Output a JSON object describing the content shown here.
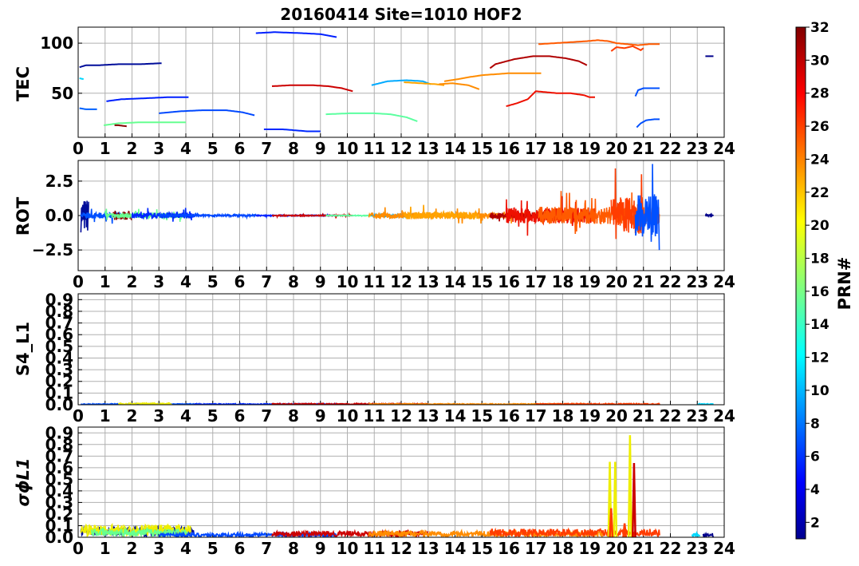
{
  "chart_data": [
    {
      "type": "line",
      "panel": "tec",
      "title": "20160414 Site=1010 HOF2",
      "ylabel": "TEC",
      "xlabel": "",
      "xlim": [
        0,
        24
      ],
      "ylim": [
        6,
        116
      ],
      "xticks": [
        "0",
        "1",
        "2",
        "3",
        "4",
        "5",
        "6",
        "7",
        "8",
        "9",
        "10",
        "11",
        "12",
        "13",
        "14",
        "15",
        "16",
        "17",
        "18",
        "19",
        "20",
        "21",
        "22",
        "23",
        "24"
      ],
      "yticks": [
        "50",
        "100"
      ],
      "grid": true,
      "series": [
        {
          "prn": 3,
          "color": "#000d9a",
          "points": [
            [
              0.05,
              76
            ],
            [
              0.3,
              78
            ],
            [
              0.8,
              78
            ],
            [
              1.5,
              79
            ],
            [
              2.3,
              79
            ],
            [
              3.1,
              80
            ]
          ]
        },
        {
          "prn": 5,
          "color": "#0020ff",
          "points": [
            [
              1.05,
              42
            ],
            [
              1.6,
              44
            ],
            [
              2.5,
              45
            ],
            [
              3.3,
              46
            ],
            [
              4.1,
              46
            ]
          ]
        },
        {
          "prn": 7,
          "color": "#0048ff",
          "points": [
            [
              3.0,
              30
            ],
            [
              3.8,
              32
            ],
            [
              4.6,
              33
            ],
            [
              5.5,
              33
            ],
            [
              6.1,
              31
            ],
            [
              6.55,
              28
            ]
          ]
        },
        {
          "prn": 8,
          "color": "#0060ff",
          "points": [
            [
              0.05,
              35
            ],
            [
              0.3,
              34
            ],
            [
              0.7,
              34
            ]
          ]
        },
        {
          "prn": 5,
          "color": "#0020ff",
          "points": [
            [
              6.6,
              110
            ],
            [
              7.3,
              111
            ],
            [
              8.3,
              110
            ],
            [
              9.0,
              109
            ],
            [
              9.6,
              106
            ]
          ]
        },
        {
          "prn": 6,
          "color": "#0028ff",
          "points": [
            [
              6.9,
              14
            ],
            [
              7.6,
              14
            ],
            [
              8.5,
              12
            ],
            [
              9.0,
              12
            ]
          ]
        },
        {
          "prn": 17,
          "color": "#66ff90",
          "points": [
            [
              0.95,
              18
            ],
            [
              1.5,
              20
            ],
            [
              2.3,
              21
            ],
            [
              3.2,
              21
            ],
            [
              4.0,
              21
            ]
          ]
        },
        {
          "prn": 16,
          "color": "#5cffa0",
          "points": [
            [
              9.2,
              29
            ],
            [
              10.1,
              30
            ],
            [
              11.0,
              30
            ],
            [
              11.6,
              29
            ],
            [
              12.2,
              26
            ],
            [
              12.6,
              22
            ]
          ]
        },
        {
          "prn": 31,
          "color": "#880000",
          "points": [
            [
              1.35,
              18
            ],
            [
              1.5,
              18
            ],
            [
              1.8,
              17
            ]
          ]
        },
        {
          "prn": 29,
          "color": "#cc0000",
          "points": [
            [
              7.2,
              57
            ],
            [
              7.9,
              58
            ],
            [
              8.7,
              58
            ],
            [
              9.3,
              57
            ],
            [
              9.8,
              55
            ],
            [
              10.2,
              52
            ]
          ]
        },
        {
          "prn": 10,
          "color": "#00aaff",
          "points": [
            [
              10.9,
              58
            ],
            [
              11.5,
              62
            ],
            [
              12.2,
              63
            ],
            [
              12.8,
              62
            ],
            [
              13.1,
              59
            ]
          ]
        },
        {
          "prn": 24,
          "color": "#ffa400",
          "points": [
            [
              12.1,
              61
            ],
            [
              12.7,
              60
            ],
            [
              13.3,
              59
            ],
            [
              13.6,
              58
            ]
          ]
        },
        {
          "prn": 25,
          "color": "#ff8c00",
          "points": [
            [
              13.4,
              59
            ],
            [
              13.9,
              60
            ],
            [
              14.5,
              58
            ],
            [
              14.9,
              54
            ]
          ]
        },
        {
          "prn": 25,
          "color": "#ff8c00",
          "points": [
            [
              13.6,
              62
            ],
            [
              14.1,
              64
            ],
            [
              14.5,
              66
            ],
            [
              15.0,
              68
            ],
            [
              15.5,
              69
            ],
            [
              16.0,
              70
            ],
            [
              16.6,
              70
            ],
            [
              17.2,
              70
            ]
          ]
        },
        {
          "prn": 30,
          "color": "#b00000",
          "points": [
            [
              15.3,
              75
            ],
            [
              15.5,
              79
            ],
            [
              16.2,
              84
            ],
            [
              16.9,
              87
            ],
            [
              17.5,
              87
            ],
            [
              18.1,
              85
            ],
            [
              18.6,
              82
            ],
            [
              18.9,
              78
            ]
          ]
        },
        {
          "prn": 28,
          "color": "#ee1000",
          "points": [
            [
              15.9,
              37
            ],
            [
              16.3,
              40
            ],
            [
              16.7,
              44
            ],
            [
              17.0,
              52
            ],
            [
              17.4,
              51
            ],
            [
              17.8,
              50
            ],
            [
              18.3,
              50
            ],
            [
              18.8,
              48
            ],
            [
              19.0,
              46
            ],
            [
              19.2,
              46
            ]
          ]
        },
        {
          "prn": 26,
          "color": "#ff5a00",
          "points": [
            [
              17.1,
              99
            ],
            [
              17.7,
              100
            ],
            [
              18.3,
              101
            ],
            [
              18.9,
              102
            ],
            [
              19.3,
              103
            ],
            [
              19.7,
              102
            ],
            [
              20.0,
              100
            ],
            [
              20.4,
              99
            ],
            [
              20.8,
              98
            ],
            [
              21.2,
              99
            ],
            [
              21.6,
              99
            ]
          ]
        },
        {
          "prn": 27,
          "color": "#ff3c00",
          "points": [
            [
              19.8,
              92
            ],
            [
              20.0,
              96
            ],
            [
              20.3,
              95
            ],
            [
              20.6,
              97
            ],
            [
              20.9,
              93
            ],
            [
              21.0,
              95
            ]
          ]
        },
        {
          "prn": 9,
          "color": "#0050ff",
          "points": [
            [
              20.7,
              47
            ],
            [
              20.8,
              53
            ],
            [
              21.0,
              55
            ],
            [
              21.3,
              55
            ],
            [
              21.6,
              55
            ]
          ]
        },
        {
          "prn": 9,
          "color": "#0050ff",
          "points": [
            [
              20.75,
              16
            ],
            [
              20.9,
              20
            ],
            [
              21.1,
              23
            ],
            [
              21.4,
              24
            ],
            [
              21.6,
              24
            ]
          ]
        },
        {
          "prn": 2,
          "color": "#00008b",
          "points": [
            [
              23.3,
              87
            ],
            [
              23.6,
              87
            ]
          ]
        },
        {
          "prn": 12,
          "color": "#00d8ff",
          "points": [
            [
              0.05,
              65
            ],
            [
              0.2,
              64
            ]
          ]
        },
        {
          "prn": 4,
          "color": "#0000d0",
          "points": [
            [
              9.2,
              5
            ],
            [
              9.3,
              5
            ]
          ]
        }
      ]
    },
    {
      "type": "line",
      "panel": "rot",
      "ylabel": "ROT",
      "xlabel": "",
      "xlim": [
        0,
        24
      ],
      "ylim": [
        -4,
        4
      ],
      "xticks": [
        "0",
        "1",
        "2",
        "3",
        "4",
        "5",
        "6",
        "7",
        "8",
        "9",
        "10",
        "11",
        "12",
        "13",
        "14",
        "15",
        "16",
        "17",
        "18",
        "19",
        "20",
        "21",
        "22",
        "23",
        "24"
      ],
      "yticks": [
        "−2.5",
        "0.0",
        "2.5"
      ],
      "grid": true,
      "series": [
        {
          "name": "",
          "color": "#000d9a",
          "range": [
            0.1,
            0.4
          ],
          "amp": 3.5
        },
        {
          "name": "",
          "color": "#0050ff",
          "range": [
            0.1,
            1.6
          ],
          "amp": 0.6
        },
        {
          "name": "",
          "color": "#880000",
          "range": [
            1.3,
            2.0
          ],
          "amp": 0.9
        },
        {
          "name": "",
          "color": "#66ff90",
          "range": [
            1.0,
            4.1
          ],
          "amp": 0.5
        },
        {
          "name": "",
          "color": "#0028ff",
          "range": [
            2.0,
            4.3
          ],
          "amp": 0.6
        },
        {
          "name": "",
          "color": "#0048ff",
          "range": [
            3.0,
            6.6
          ],
          "amp": 0.2
        },
        {
          "name": "",
          "color": "#0020ff",
          "range": [
            6.6,
            9.6
          ],
          "amp": 0.1
        },
        {
          "name": "",
          "color": "#cc0000",
          "range": [
            7.2,
            10.2
          ],
          "amp": 0.1
        },
        {
          "name": "",
          "color": "#5cffa0",
          "range": [
            9.2,
            12.6
          ],
          "amp": 0.07
        },
        {
          "name": "",
          "color": "#00aaff",
          "range": [
            10.9,
            13.1
          ],
          "amp": 0.2
        },
        {
          "name": "",
          "color": "#ff8c00",
          "range": [
            10.8,
            17.2
          ],
          "amp": 0.6
        },
        {
          "name": "",
          "color": "#ffa400",
          "range": [
            12.1,
            14.9
          ],
          "amp": 0.8
        },
        {
          "name": "",
          "color": "#b00000",
          "range": [
            15.3,
            19.0
          ],
          "amp": 0.6
        },
        {
          "name": "",
          "color": "#ee1000",
          "range": [
            15.9,
            19.2
          ],
          "amp": 1.6
        },
        {
          "name": "",
          "color": "#ff5a00",
          "range": [
            17.1,
            21.6
          ],
          "amp": 1.8
        },
        {
          "name": "",
          "color": "#ff3c00",
          "range": [
            19.8,
            21.0
          ],
          "amp": 3.8
        },
        {
          "name": "",
          "color": "#0050ff",
          "range": [
            20.7,
            21.6
          ],
          "amp": 4.5
        },
        {
          "name": "",
          "color": "#00008b",
          "range": [
            23.3,
            23.6
          ],
          "amp": 0.2
        }
      ]
    },
    {
      "type": "line",
      "panel": "s4",
      "ylabel": "S4_L1",
      "xlabel": "",
      "xlim": [
        0,
        24
      ],
      "ylim": [
        0,
        0.95
      ],
      "xticks": [
        "0",
        "1",
        "2",
        "3",
        "4",
        "5",
        "6",
        "7",
        "8",
        "9",
        "10",
        "11",
        "12",
        "13",
        "14",
        "15",
        "16",
        "17",
        "18",
        "19",
        "20",
        "21",
        "22",
        "23",
        "24"
      ],
      "yticks": [
        "0.0",
        "0.1",
        "0.2",
        "0.3",
        "0.4",
        "0.5",
        "0.6",
        "0.7",
        "0.8",
        "0.9"
      ],
      "grid": true,
      "series": [
        {
          "name": "",
          "color": "#0050ff",
          "range": [
            0.1,
            4.3
          ],
          "level": 0.005
        },
        {
          "name": "",
          "color": "#eeee00",
          "range": [
            1.5,
            3.5
          ],
          "level": 0.008
        },
        {
          "name": "",
          "color": "#0028ff",
          "range": [
            4.3,
            9.6
          ],
          "level": 0.005
        },
        {
          "name": "",
          "color": "#cc0000",
          "range": [
            7.2,
            13.0
          ],
          "level": 0.006
        },
        {
          "name": "",
          "color": "#ff8c00",
          "range": [
            10.8,
            19.0
          ],
          "level": 0.005
        },
        {
          "name": "",
          "color": "#ff3c00",
          "range": [
            17.0,
            21.6
          ],
          "level": 0.006
        },
        {
          "name": "",
          "color": "#00d8ff",
          "range": [
            23.0,
            23.6
          ],
          "level": 0.005
        }
      ]
    },
    {
      "type": "line",
      "panel": "sigma",
      "ylabel": "σϕL1",
      "xlabel": "",
      "xlim": [
        0,
        24
      ],
      "ylim": [
        0,
        0.95
      ],
      "xticks": [
        "0",
        "1",
        "2",
        "3",
        "4",
        "5",
        "6",
        "7",
        "8",
        "9",
        "10",
        "11",
        "12",
        "13",
        "14",
        "15",
        "16",
        "17",
        "18",
        "19",
        "20",
        "21",
        "22",
        "23",
        "24"
      ],
      "yticks": [
        "0.0",
        "0.1",
        "0.2",
        "0.3",
        "0.4",
        "0.5",
        "0.6",
        "0.7",
        "0.8",
        "0.9"
      ],
      "grid": true,
      "series": [
        {
          "name": "",
          "color": "#000d9a",
          "range": [
            0.1,
            4.3
          ],
          "level": 0.05
        },
        {
          "name": "",
          "color": "#eeee00",
          "range": [
            0.1,
            4.2
          ],
          "level": 0.06
        },
        {
          "name": "",
          "color": "#66ff90",
          "range": [
            0.5,
            4.1
          ],
          "level": 0.04
        },
        {
          "name": "",
          "color": "#0048ff",
          "range": [
            3.0,
            9.6
          ],
          "level": 0.02
        },
        {
          "name": "",
          "color": "#cc0000",
          "range": [
            7.2,
            13.0
          ],
          "level": 0.03
        },
        {
          "name": "",
          "color": "#ff8c00",
          "range": [
            10.8,
            19.5
          ],
          "level": 0.03
        },
        {
          "name": "",
          "color": "#ff3c00",
          "range": [
            15.3,
            21.6
          ],
          "level": 0.04
        },
        {
          "name": "",
          "color": "#00008b",
          "range": [
            23.2,
            23.6
          ],
          "level": 0.02
        },
        {
          "name": "",
          "color": "#00d8ff",
          "range": [
            22.8,
            23.1
          ],
          "level": 0.02
        }
      ],
      "spikes": [
        {
          "x": 19.75,
          "y": 0.65,
          "color": "#eeee00"
        },
        {
          "x": 19.95,
          "y": 0.65,
          "color": "#eeee00"
        },
        {
          "x": 20.5,
          "y": 0.88,
          "color": "#eeee00"
        },
        {
          "x": 19.8,
          "y": 0.25,
          "color": "#ff3c00"
        },
        {
          "x": 20.65,
          "y": 0.64,
          "color": "#cc0000"
        },
        {
          "x": 20.3,
          "y": 0.12,
          "color": "#ff3c00"
        }
      ]
    }
  ],
  "colorbar": {
    "label": "PRN#",
    "min": 1,
    "max": 32,
    "ticks": [
      "2",
      "4",
      "6",
      "8",
      "10",
      "12",
      "14",
      "16",
      "18",
      "20",
      "22",
      "24",
      "26",
      "28",
      "30",
      "32"
    ]
  }
}
